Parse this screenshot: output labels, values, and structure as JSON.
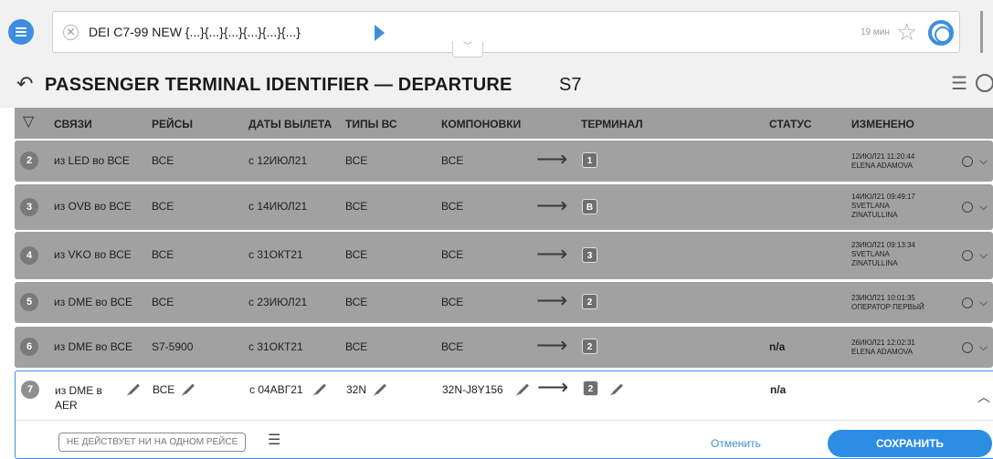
{
  "command": {
    "text": "DEI C7-99 NEW {...}{...}{...}{...}{...}{...}",
    "time": "19 мин"
  },
  "title": {
    "main": "PASSENGER TERMINAL IDENTIFIER — DEPARTURE",
    "sub": "S7"
  },
  "columns": {
    "links": "СВЯЗИ",
    "flights": "РЕЙСЫ",
    "dates": "ДАТЫ ВЫЛЕТА",
    "aircraft": "ТИПЫ ВС",
    "configs": "КОМПОНОВКИ",
    "terminal": "ТЕРМИНАЛ",
    "status": "СТАТУС",
    "changed": "ИЗМЕНЕНО"
  },
  "rows": [
    {
      "num": "2",
      "link": "из LED во ВСЕ",
      "flights": "ВСЕ",
      "dates": "с 12ИЮЛ21",
      "aircraft": "ВСЕ",
      "configs": "ВСЕ",
      "terminal": "1",
      "status": "",
      "changed": [
        "12ИЮЛ21 11:20:44",
        "ELENA ADAMOVA"
      ]
    },
    {
      "num": "3",
      "link": "из OVB во ВСЕ",
      "flights": "ВСЕ",
      "dates": "с 14ИЮЛ21",
      "aircraft": "ВСЕ",
      "configs": "ВСЕ",
      "terminal": "B",
      "status": "",
      "changed": [
        "14ИЮЛ21 09:49:17",
        "SVETLANA",
        "ZINATULLINA"
      ]
    },
    {
      "num": "4",
      "link": "из VKO во ВСЕ",
      "flights": "ВСЕ",
      "dates": "с 31ОКТ21",
      "aircraft": "ВСЕ",
      "configs": "ВСЕ",
      "terminal": "3",
      "status": "",
      "changed": [
        "23ИЮЛ21 09:13:34",
        "SVETLANA",
        "ZINATULLINA"
      ]
    },
    {
      "num": "5",
      "link": "из DME во ВСЕ",
      "flights": "ВСЕ",
      "dates": "с 23ИЮЛ21",
      "aircraft": "ВСЕ",
      "configs": "ВСЕ",
      "terminal": "2",
      "status": "",
      "changed": [
        "23ИЮЛ21 10:01:35",
        "ОПЕРАТОР ПЕРВЫЙ"
      ]
    },
    {
      "num": "6",
      "link": "из DME во ВСЕ",
      "flights": "S7-5900",
      "dates": "с 31ОКТ21",
      "aircraft": "ВСЕ",
      "configs": "ВСЕ",
      "terminal": "2",
      "status": "n/a",
      "changed": [
        "26ИЮЛ21 12:02:31",
        "ELENA ADAMOVA"
      ]
    }
  ],
  "edit_row": {
    "num": "7",
    "link_line1": "из DME в",
    "link_line2": "AER",
    "flights": "ВСЕ",
    "dates": "с 04АВГ21",
    "aircraft": "32N",
    "configs": "32N-J8Y156",
    "terminal": "2",
    "status": "n/a",
    "tag_label": "НЕ ДЕЙСТВУЕТ НИ НА ОДНОМ РЕЙСЕ",
    "cancel_label": "Отменить",
    "save_label": "СОХРАНИТЬ"
  },
  "icons": {
    "menu": "menu-icon",
    "clear": "clear-icon",
    "run": "play-icon",
    "star": "star-icon",
    "help": "lifebuoy-icon",
    "back": "back-icon",
    "filter": "filter-icon",
    "history": "history-icon"
  },
  "colors": {
    "accent": "#3d8ee0",
    "row_bg": "#a1a1a1",
    "header_bg": "#9e9e9e"
  }
}
